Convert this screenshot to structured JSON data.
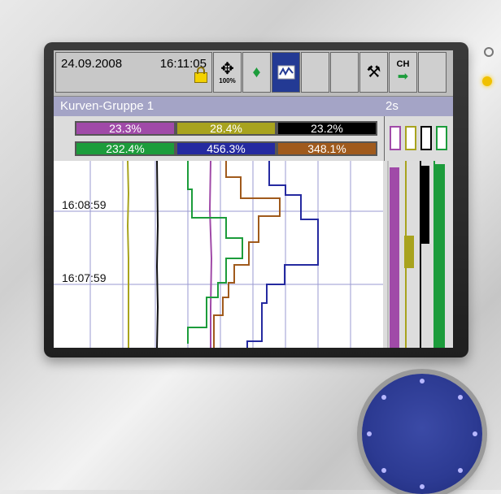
{
  "status": {
    "date": "24.09.2008",
    "time": "16:11:05"
  },
  "toolbar": {
    "zoom_label": "100%",
    "channel_label": "CH"
  },
  "group": {
    "name": "Kurven-Gruppe 1",
    "interval": "2s"
  },
  "channels": [
    {
      "value": "23.3%",
      "color": "#a04aa8"
    },
    {
      "value": "28.4%",
      "color": "#a8a31e"
    },
    {
      "value": "23.2%",
      "color": "#000000"
    },
    {
      "value": "232.4%",
      "color": "#1c9c3b"
    },
    {
      "value": "456.3%",
      "color": "#252aa0"
    },
    {
      "value": "348.1%",
      "color": "#a05a1c"
    }
  ],
  "time_labels": [
    "16:08:59",
    "16:07:59"
  ],
  "icons": [
    "diamond-arrows-icon",
    "alarm-bell-icon",
    "waveform-icon",
    "tools-icon",
    "channel-arrow-icon",
    "lock-icon"
  ]
}
